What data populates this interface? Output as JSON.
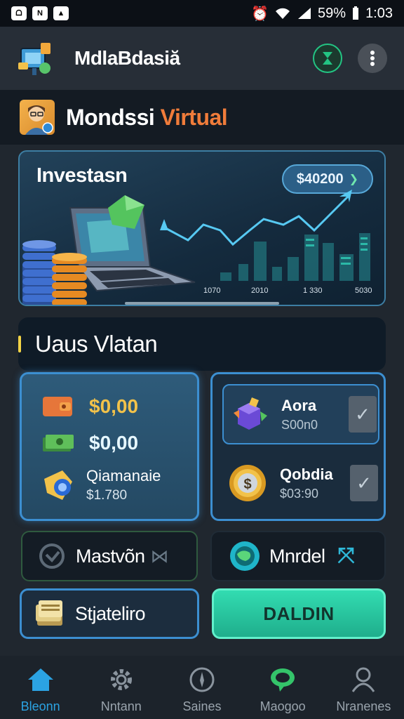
{
  "status_bar": {
    "battery": "59%",
    "time": "1:03"
  },
  "header": {
    "title": "MdlaBdasiă"
  },
  "subheader": {
    "title_main": "Mondssi",
    "title_accent": "Virtual"
  },
  "hero": {
    "title": "Investasn",
    "pill_value": "$40200",
    "chart_ticks": [
      "1070",
      "2010",
      "1 330",
      "5030"
    ]
  },
  "section": {
    "title": "Uaus Vlatan"
  },
  "wallet": {
    "rows": [
      {
        "icon": "wallet-orange-icon",
        "value": "$0,00"
      },
      {
        "icon": "cash-stack-icon",
        "value": "$0,00"
      },
      {
        "icon": "gold-shield-icon",
        "name": "Qiamanaie",
        "value": "$1.780"
      }
    ]
  },
  "assets": {
    "items": [
      {
        "icon": "crystal-cube-icon",
        "name": "Aora",
        "value": "S00n0"
      },
      {
        "icon": "gold-coin-icon",
        "name": "Qobdia",
        "value": "$03:90"
      }
    ]
  },
  "actions": {
    "mastvon": "Mastvõn",
    "mnrdel": "Mnrdel",
    "stjateliro": "Stjateliro",
    "daldin": "DALDIN"
  },
  "bottom_nav": [
    {
      "icon": "home-icon",
      "label": "Bleonn",
      "active": true
    },
    {
      "icon": "gear-icon",
      "label": "Nntann"
    },
    {
      "icon": "compass-icon",
      "label": "Saines"
    },
    {
      "icon": "chat-icon",
      "label": "Maogoo"
    },
    {
      "icon": "user-icon",
      "label": "Nranenes"
    }
  ],
  "colors": {
    "accent_orange": "#f07c3a",
    "accent_teal": "#2fd6ac",
    "nav_active": "#2ba3e3",
    "border_blue": "#3c8fd1"
  }
}
